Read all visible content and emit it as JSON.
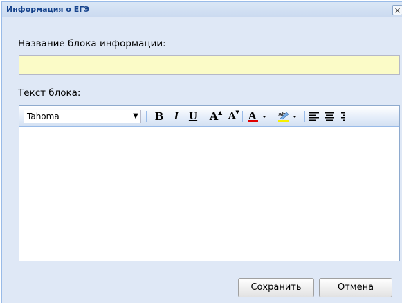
{
  "window": {
    "title": "Информация о ЕГЭ",
    "close_label": "×"
  },
  "form": {
    "name_label": "Название блока информации:",
    "name_value": "",
    "text_label": "Текст блока:"
  },
  "editor": {
    "font_value": "Tahoma",
    "toolbar": {
      "bold": "B",
      "italic": "I",
      "underline": "U",
      "grow": "A",
      "shrink": "A",
      "font_color_accent": "#e00000",
      "highlight_accent": "#f8f000",
      "highlight_text": "ab"
    },
    "content": ""
  },
  "buttons": {
    "save_label": "Сохранить",
    "cancel_label": "Отмена"
  },
  "colors": {
    "window_bg": "#dfe8f6",
    "title_text": "#15428b",
    "input_bg": "#fbfbc7"
  }
}
